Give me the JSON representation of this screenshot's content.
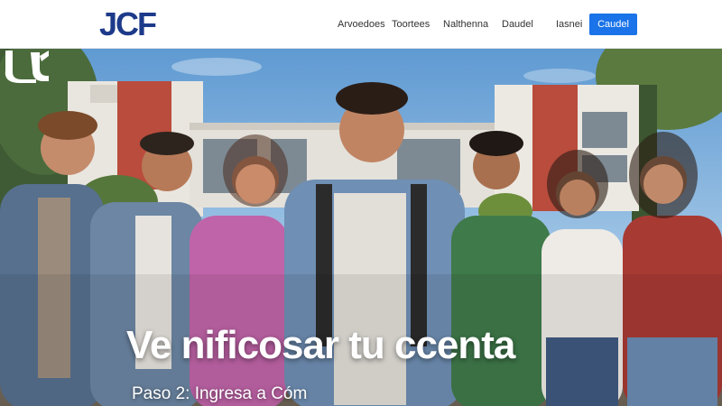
{
  "brand": {
    "logo_text": "JCF",
    "logo_color": "#1d3a8a"
  },
  "nav": {
    "items": [
      {
        "label": "Arvoedoes"
      },
      {
        "label": "Toortees"
      },
      {
        "label": "Nalthenna"
      },
      {
        "label": "Daudel"
      },
      {
        "label": "Iasnei"
      }
    ],
    "cta_label": "Caudel",
    "cta_color": "#1a73e8"
  },
  "hero": {
    "headline": "Ve nificosar tu ccenta",
    "subline": "Paso 2: Ingresa a Cóm",
    "sky_color": "#6fa6d8",
    "building_color": "#b94c3c"
  }
}
